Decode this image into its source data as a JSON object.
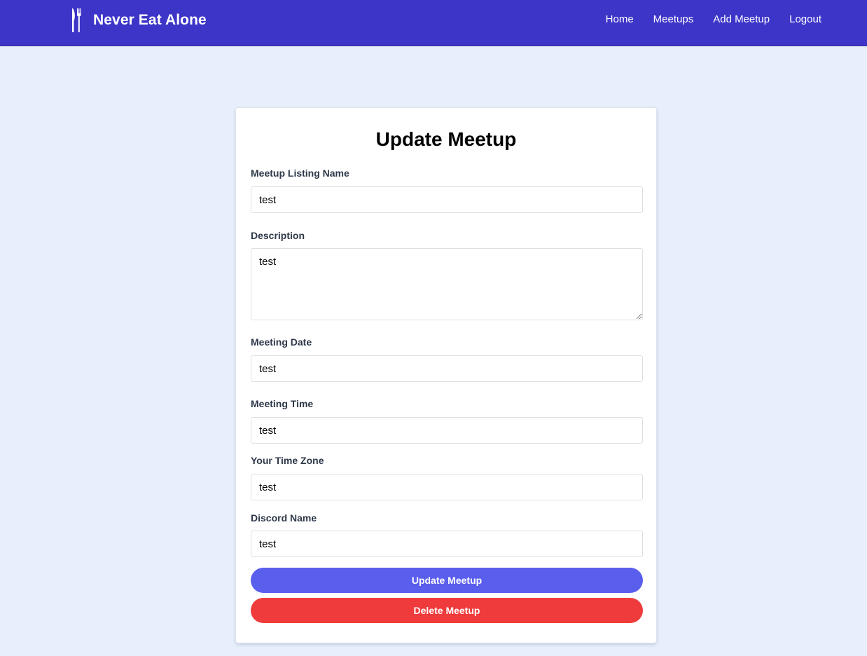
{
  "navbar": {
    "brand_icon": "fork-knife-icon",
    "brand_name": "Never Eat Alone",
    "links": [
      "Home",
      "Meetups",
      "Add Meetup",
      "Logout"
    ]
  },
  "form": {
    "title": "Update Meetup",
    "fields": {
      "listing_name": {
        "label": "Meetup Listing Name",
        "value": "test"
      },
      "description": {
        "label": "Description",
        "value": "test"
      },
      "date": {
        "label": "Meeting Date",
        "value": "test"
      },
      "time": {
        "label": "Meeting Time",
        "value": "test"
      },
      "timezone": {
        "label": "Your Time Zone",
        "value": "test"
      },
      "discord": {
        "label": "Discord Name",
        "value": "test"
      }
    },
    "update_label": "Update Meetup",
    "delete_label": "Delete Meetup"
  },
  "colors": {
    "navbar": "#3d35c8",
    "background": "#e8effc",
    "update_button": "#5a5eec",
    "delete_button": "#ef3b3b"
  }
}
